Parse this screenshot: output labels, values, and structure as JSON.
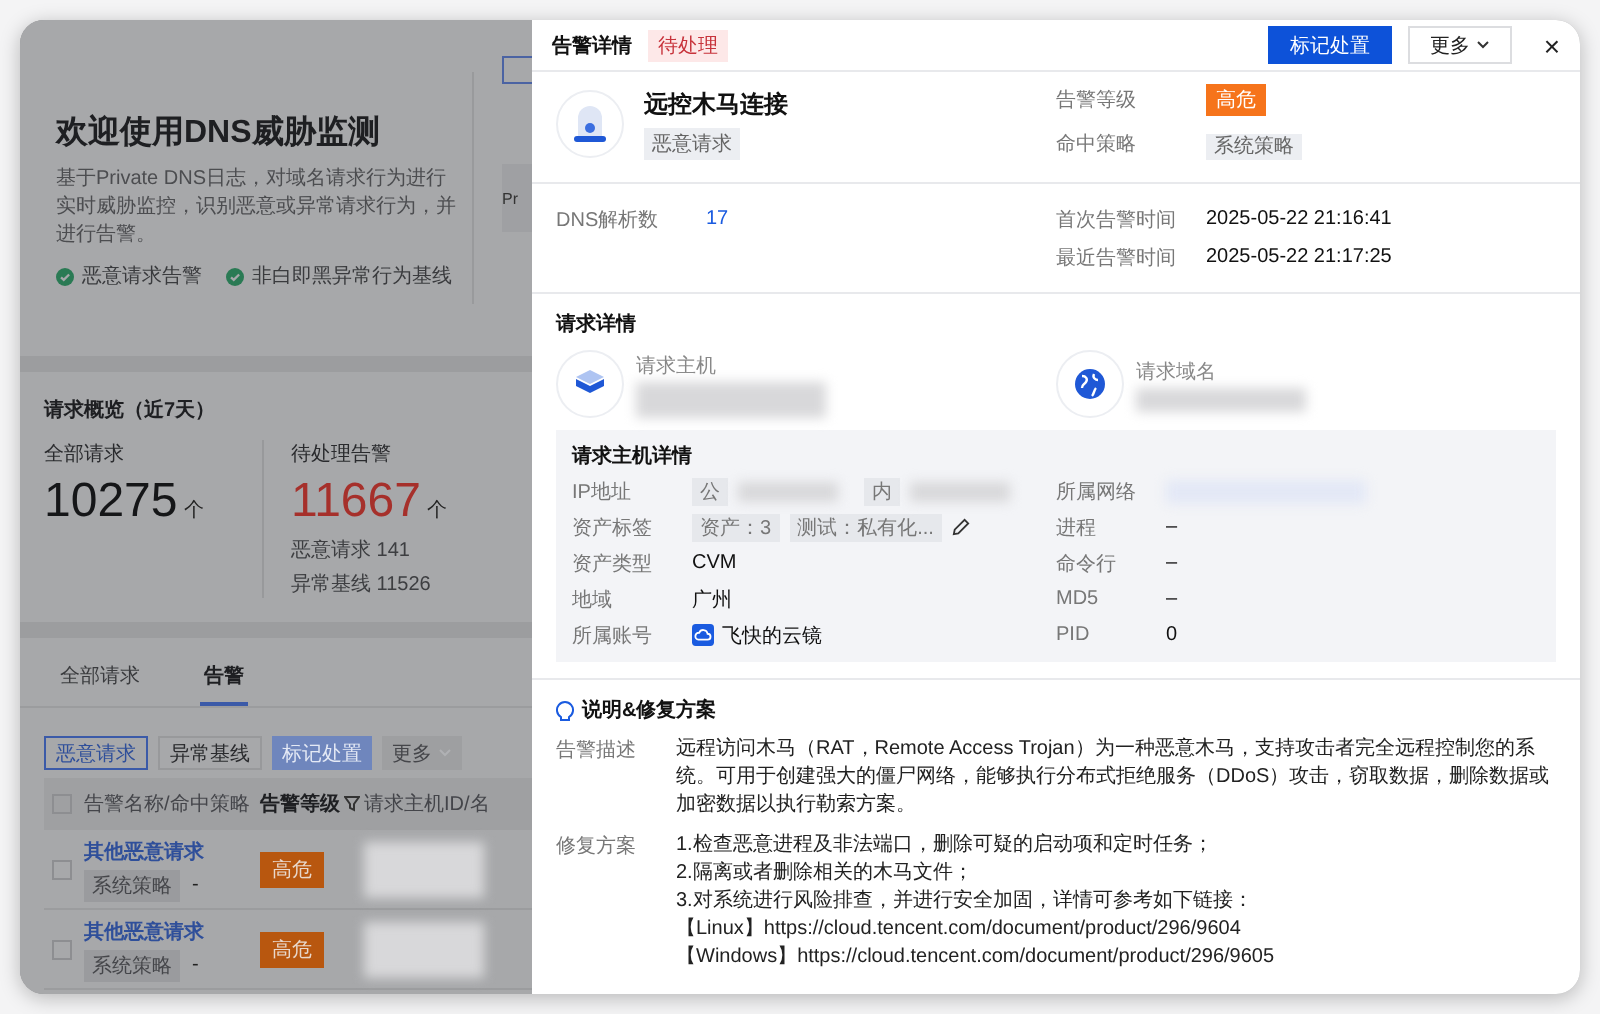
{
  "page": {
    "welcome": {
      "title": "欢迎使用DNS威胁监测",
      "description": "基于Private DNS日志，对域名请求行为进行实时威胁监控，识别恶意或异常请求行为，并进行告警。",
      "features": [
        "恶意请求告警",
        "非白即黑异常行为基线"
      ],
      "side_text": "Pr"
    },
    "overview": {
      "title": "请求概览（近7天）",
      "total": {
        "label": "全部请求",
        "value": "10275",
        "unit": "个"
      },
      "pending": {
        "label": "待处理告警",
        "value": "11667",
        "unit": "个",
        "breakdown": [
          {
            "label": "恶意请求",
            "value": "141"
          },
          {
            "label": "异常基线",
            "value": "11526"
          }
        ]
      }
    },
    "tabs": [
      {
        "label": "全部请求",
        "selected": false
      },
      {
        "label": "告警",
        "selected": true
      }
    ],
    "filters": [
      {
        "label": "恶意请求",
        "selected": true
      },
      {
        "label": "异常基线",
        "selected": false
      }
    ],
    "actions": [
      {
        "label": "标记处置",
        "kind": "primary",
        "disabled": true
      },
      {
        "label": "更多",
        "kind": "dropdown",
        "disabled": true
      }
    ],
    "table": {
      "all_checked": false,
      "columns": [
        "告警名称/命中策略",
        "告警等级",
        "请求主机ID/名"
      ],
      "rows": [
        {
          "name": "其他恶意请求",
          "policy": "系统策略",
          "extra": "-",
          "level": "高危",
          "checked": false
        },
        {
          "name": "其他恶意请求",
          "policy": "系统策略",
          "extra": "-",
          "level": "高危",
          "checked": false
        }
      ]
    }
  },
  "drawer": {
    "title": "告警详情",
    "status": "待处理",
    "buttons": [
      {
        "label": "标记处置",
        "kind": "primary"
      },
      {
        "label": "更多",
        "kind": "dropdown"
      }
    ],
    "close": "×",
    "alert": {
      "name": "远控木马连接",
      "type": "恶意请求",
      "fields": [
        {
          "label": "告警等级",
          "value": "高危",
          "kind": "danger"
        },
        {
          "label": "命中策略",
          "value": "系统策略",
          "kind": "tag"
        }
      ]
    },
    "stats": {
      "left": [
        {
          "label": "DNS解析数",
          "value": "17",
          "kind": "link"
        }
      ],
      "right": [
        {
          "label": "首次告警时间",
          "value": "2025-05-22 21:16:41",
          "kind": "text"
        },
        {
          "label": "最近告警时间",
          "value": "2025-05-22 21:17:25",
          "kind": "text"
        }
      ]
    },
    "request": {
      "title": "请求详情",
      "host_label": "请求主机",
      "domain_label": "请求域名"
    },
    "host_details": {
      "title": "请求主机详情",
      "left": [
        {
          "label": "IP地址",
          "kind": "ip",
          "tags": [
            "公",
            "内"
          ]
        },
        {
          "label": "资产标签",
          "kind": "tags",
          "tags": [
            "资产：3",
            "测试：私有化..."
          ],
          "editable": true
        },
        {
          "label": "资产类型",
          "kind": "text",
          "value": "CVM"
        },
        {
          "label": "地域",
          "kind": "text",
          "value": "广州"
        },
        {
          "label": "所属账号",
          "kind": "account",
          "value": "飞快的云镜"
        }
      ],
      "right": [
        {
          "label": "所属网络",
          "kind": "redacted"
        },
        {
          "label": "进程",
          "kind": "text",
          "value": "–"
        },
        {
          "label": "命令行",
          "kind": "text",
          "value": "–"
        },
        {
          "label": "MD5",
          "kind": "text",
          "value": "–"
        },
        {
          "label": "PID",
          "kind": "text",
          "value": "0"
        }
      ]
    },
    "solution": {
      "title": "说明&修复方案",
      "description_label": "告警描述",
      "description": "远程访问木马（RAT，Remote Access Trojan）为一种恶意木马，支持攻击者完全远程控制您的系统。可用于创建强大的僵尸网络，能够执行分布式拒绝服务（DDoS）攻击，窃取数据，删除数据或加密数据以执行勒索方案。",
      "fix_label": "修复方案",
      "fix_lines": [
        "1.检查恶意进程及非法端口，删除可疑的启动项和定时任务；",
        "2.隔离或者删除相关的木马文件；",
        "3.对系统进行风险排查，并进行安全加固，详情可参考如下链接：",
        "【Linux】https://cloud.tencent.com/document/product/296/9604",
        "【Windows】https://cloud.tencent.com/document/product/296/9605"
      ]
    }
  }
}
